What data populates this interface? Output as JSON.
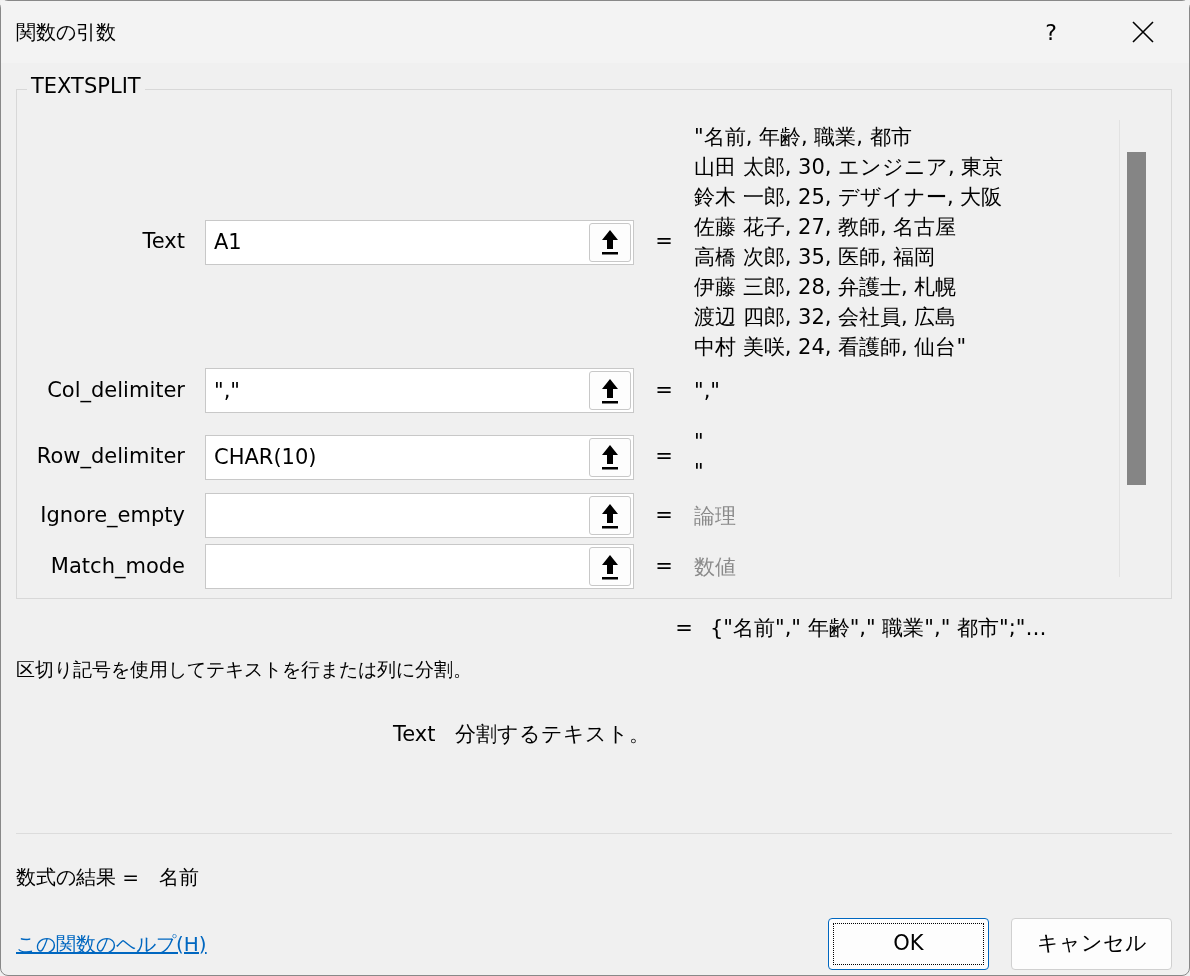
{
  "window": {
    "title": "関数の引数",
    "help_button": "?"
  },
  "function_name": "TEXTSPLIT",
  "arguments": [
    {
      "label": "Text",
      "value": "A1",
      "equals": "=",
      "greyed": false,
      "result_lines": [
        "\"名前, 年齢, 職業, 都市",
        "山田 太郎, 30, エンジニア, 東京",
        "鈴木 一郎, 25, デザイナー, 大阪",
        "佐藤 花子, 27, 教師, 名古屋",
        "高橋 次郎, 35, 医師, 福岡",
        "伊藤 三郎, 28, 弁護士, 札幌",
        "渡辺 四郎, 32, 会社員, 広島",
        "中村 美咲, 24, 看護師, 仙台\""
      ]
    },
    {
      "label": "Col_delimiter",
      "value": "\",\"",
      "equals": "=",
      "greyed": false,
      "result_lines": [
        "\",\""
      ]
    },
    {
      "label": "Row_delimiter",
      "value": "CHAR(10)",
      "equals": "=",
      "greyed": false,
      "result_lines": [
        "\"",
        "\""
      ]
    },
    {
      "label": "Ignore_empty",
      "equals": "=",
      "greyed": true,
      "result_lines": [
        "論理"
      ]
    },
    {
      "label": "Match_mode",
      "equals": "=",
      "greyed": true,
      "result_lines": [
        "数値"
      ]
    }
  ],
  "function_result": {
    "equals": "=",
    "value": "{\"名前\",\" 年齢\",\" 職業\",\" 都市\";\"…"
  },
  "description": "区切り記号を使用してテキストを行または列に分割。",
  "argument_help": {
    "name": "Text",
    "text": "分割するテキスト。"
  },
  "formula_result": {
    "label": "数式の結果 =",
    "value": "名前"
  },
  "help_link": "この関数のヘルプ(H)",
  "buttons": [
    {
      "label": "OK",
      "default": true
    },
    {
      "label": "キャンセル",
      "default": false
    }
  ]
}
